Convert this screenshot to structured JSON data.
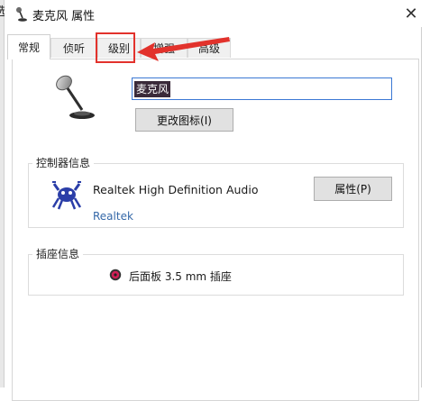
{
  "window": {
    "title": "麦克风 属性",
    "close_symbol": "✕",
    "left_cut_char": "选"
  },
  "tabs": [
    {
      "label": "常规",
      "active": true
    },
    {
      "label": "侦听",
      "active": false
    },
    {
      "label": "级别",
      "active": false,
      "highlighted": true
    },
    {
      "label": "增强",
      "active": false
    },
    {
      "label": "高级",
      "active": false
    }
  ],
  "device": {
    "icon": "microphone-icon",
    "name_value": "麦克风",
    "change_icon_label": "更改图标(I)"
  },
  "controller": {
    "group_title": "控制器信息",
    "icon": "realtek-crab-icon",
    "name": "Realtek High Definition Audio",
    "link_label": "Realtek",
    "properties_label": "属性(P)"
  },
  "jack": {
    "group_title": "插座信息",
    "icon": "jack-port-icon",
    "label": "后面板 3.5 mm 插座",
    "color": "#d01f55"
  },
  "annotation": {
    "highlight_color": "#e2322c",
    "arrow_color": "#e2322c"
  }
}
